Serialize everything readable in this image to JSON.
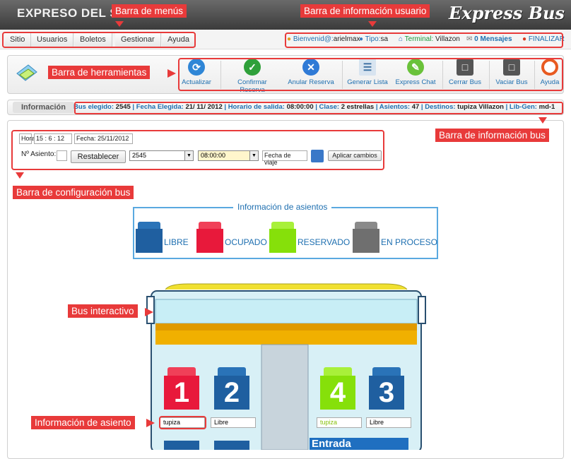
{
  "header": {
    "title": "EXPRESO DEL S",
    "brand": "Express Bus"
  },
  "menu": {
    "items": [
      "Sitio",
      "Usuarios",
      "Boletos",
      "Gestionar",
      "Ayuda"
    ]
  },
  "user": {
    "welcome_label": "Bienvenid@:",
    "username": "arielmax",
    "type_label": "Tipo:",
    "type_value": "sa",
    "terminal_label": "Terminal:",
    "terminal_value": "Villazon",
    "messages": "0 Mensajes",
    "logout": "FINALIZAR"
  },
  "toolbar": {
    "items": [
      {
        "label": "Actualizar",
        "icon": "refresh-icon"
      },
      {
        "label": "Confirmar Reserva",
        "icon": "check-icon"
      },
      {
        "label": "Anular Reserva",
        "icon": "cancel-icon"
      },
      {
        "label": "Generar Lista",
        "icon": "list-icon"
      },
      {
        "label": "Express Chat",
        "icon": "chat-icon"
      },
      {
        "label": "Cerrar Bus",
        "icon": "bus-close-icon"
      },
      {
        "label": "Vaciar Bus",
        "icon": "bus-empty-icon"
      },
      {
        "label": "Ayuda",
        "icon": "lifebuoy-icon"
      }
    ]
  },
  "info": {
    "tag": "Información",
    "bus_label": "Bus elegido:",
    "bus_value": "2545",
    "date_label": "Fecha Elegida:",
    "date_value": "21/ 11/ 2012",
    "time_label": "Horario de salida:",
    "time_value": "08:00:00",
    "class_label": "Clase:",
    "class_value": "2 estrellas",
    "seats_label": "Asientos:",
    "seats_value": "47",
    "dest_label": "Destinos:",
    "dest_value": "tupiza Villazon",
    "lib_label": "Lib-Gen:",
    "lib_value": "md-1"
  },
  "config": {
    "hora_label": "Hora",
    "hora_value": "15 : 6 : 12",
    "fecha_value": "Fecha: 25/11/2012",
    "seat_label": "Nº Asiento:",
    "reset_button": "Restablecer",
    "bus_select": "2545",
    "time_select": "08:00:00",
    "travel_date_placeholder": "Fecha de viaje",
    "apply_button": "Aplicar cambios"
  },
  "legend": {
    "title": "Información de asientos",
    "items": [
      {
        "label": "LIBRE",
        "color": "#1f5fa0"
      },
      {
        "label": "OCUPADO",
        "color": "#e8193b"
      },
      {
        "label": "RESERVADO",
        "color": "#86e00a"
      },
      {
        "label": "EN PROCESO",
        "color": "#6f6f6f"
      }
    ]
  },
  "seats": [
    {
      "number": "1",
      "status": "ocupado",
      "name": "tupiza"
    },
    {
      "number": "2",
      "status": "libre",
      "name": "Libre"
    },
    {
      "number": "4",
      "status": "reservado",
      "name": "tupiza"
    },
    {
      "number": "3",
      "status": "libre",
      "name": "Libre"
    }
  ],
  "bus": {
    "entrance_label": "Entrada"
  },
  "annotations": {
    "menu_bar": "Barra de menús",
    "user_info_bar": "Barra de información usuario",
    "toolbar": "Barra de herramientas",
    "bus_info_bar": "Barra de información bus",
    "bus_config_bar": "Barra de configuración bus",
    "interactive_bus": "Bus interactivo",
    "seat_info": "Información de asiento"
  }
}
